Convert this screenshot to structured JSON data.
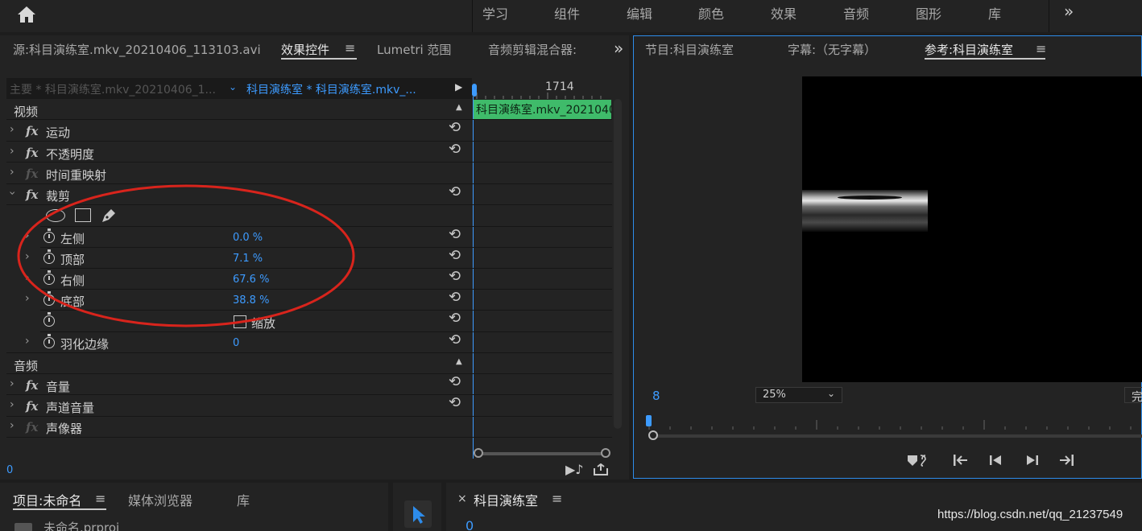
{
  "topbar": {
    "workspaces": [
      "学习",
      "组件",
      "编辑",
      "颜色",
      "效果",
      "音频",
      "图形",
      "库"
    ],
    "more": "»"
  },
  "effect_panel": {
    "tabs": {
      "source": "源:科目演练室.mkv_20210406_113103.avi",
      "effect_controls": "效果控件",
      "lumetri": "Lumetri 范围",
      "audio_mixer": "音频剪辑混合器:"
    },
    "master_clip": "主要 * 科目演练室.mkv_20210406_1...",
    "sequence_clip": "科目演练室 * 科目演练室.mkv_...",
    "timecode_mark": "1714",
    "clip_name": "科目演练室.mkv_2021040",
    "video_section": "视频",
    "video_effects": {
      "motion": "运动",
      "opacity": "不透明度",
      "time_remap": "时间重映射",
      "crop": "裁剪"
    },
    "crop_params": {
      "left_label": "左侧",
      "left_value": "0.0 %",
      "top_label": "顶部",
      "top_value": "7.1 %",
      "right_label": "右侧",
      "right_value": "67.6 %",
      "bottom_label": "底部",
      "bottom_value": "38.8 %",
      "zoom_label": "缩放",
      "feather_label": "羽化边缘",
      "feather_value": "0"
    },
    "audio_section": "音频",
    "audio_effects": {
      "volume": "音量",
      "channel_volume": "声道音量",
      "panner": "声像器"
    },
    "footer_time": "0"
  },
  "program_panel": {
    "tabs": {
      "program": "节目:科目演练室",
      "captions": "字幕:（无字幕）",
      "reference": "参考:科目演练室"
    },
    "timecode": "8",
    "zoom": "25%",
    "fit_label": "完"
  },
  "project_panel": {
    "tabs": {
      "project": "项目:未命名",
      "media_browser": "媒体浏览器",
      "library": "库"
    },
    "file": "未命名.prproj"
  },
  "timeline_panel": {
    "tab": "科目演练室",
    "close": "×",
    "timecode": "0"
  },
  "watermark": "https://blog.csdn.net/qq_21237549",
  "colors": {
    "accent_blue": "#3d9bff",
    "clip_green": "#3fbb6a",
    "annotation_red": "#d8241c"
  }
}
